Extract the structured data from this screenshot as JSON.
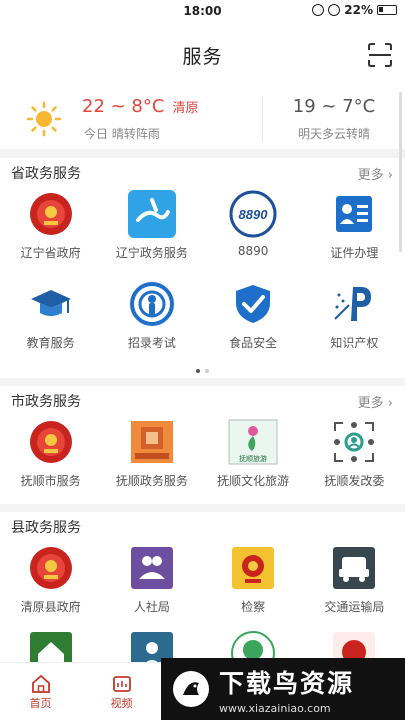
{
  "status": {
    "time": "18:00",
    "battery": "22%"
  },
  "header": {
    "title": "服务"
  },
  "weather": {
    "today_temp": "22 ~ 8°C",
    "location": "清原",
    "today_desc": "今日 晴转阵雨",
    "tomorrow_temp": "19 ~ 7°C",
    "tomorrow_desc": "明天多云转晴"
  },
  "province": {
    "title": "省政务服务",
    "more": "更多",
    "items": [
      {
        "label": "辽宁省政府",
        "icon": "emblem-icon"
      },
      {
        "label": "辽宁政务服务",
        "icon": "liaoning-service-icon"
      },
      {
        "label": "8890",
        "icon": "8890-icon",
        "badge": "8890"
      },
      {
        "label": "证件办理",
        "icon": "id-card-icon"
      },
      {
        "label": "教育服务",
        "icon": "graduation-cap-icon"
      },
      {
        "label": "招录考试",
        "icon": "exam-icon"
      },
      {
        "label": "食品安全",
        "icon": "shield-check-icon"
      },
      {
        "label": "知识产权",
        "icon": "ip-icon"
      }
    ]
  },
  "city": {
    "title": "市政务服务",
    "more": "更多",
    "items": [
      {
        "label": "抚顺市服务",
        "icon": "emblem-icon"
      },
      {
        "label": "抚顺政务服务",
        "icon": "fushun-service-icon"
      },
      {
        "label": "抚顺文化旅游",
        "icon": "tourism-icon",
        "badge": "抚顺旅游"
      },
      {
        "label": "抚顺发改委",
        "icon": "network-icon"
      }
    ]
  },
  "county": {
    "title": "县政务服务",
    "items": [
      {
        "label": "清原县政府",
        "icon": "emblem-icon"
      },
      {
        "label": "人社局",
        "icon": "people-icon"
      },
      {
        "label": "检察",
        "icon": "procuratorate-icon"
      },
      {
        "label": "交通运输局",
        "icon": "transport-icon"
      }
    ]
  },
  "tabs": [
    {
      "label": "首页",
      "icon": "home-icon"
    },
    {
      "label": "视频",
      "icon": "video-icon"
    }
  ],
  "watermark": {
    "main": "下载鸟资源",
    "sub": "www.xiazainiao.com"
  }
}
